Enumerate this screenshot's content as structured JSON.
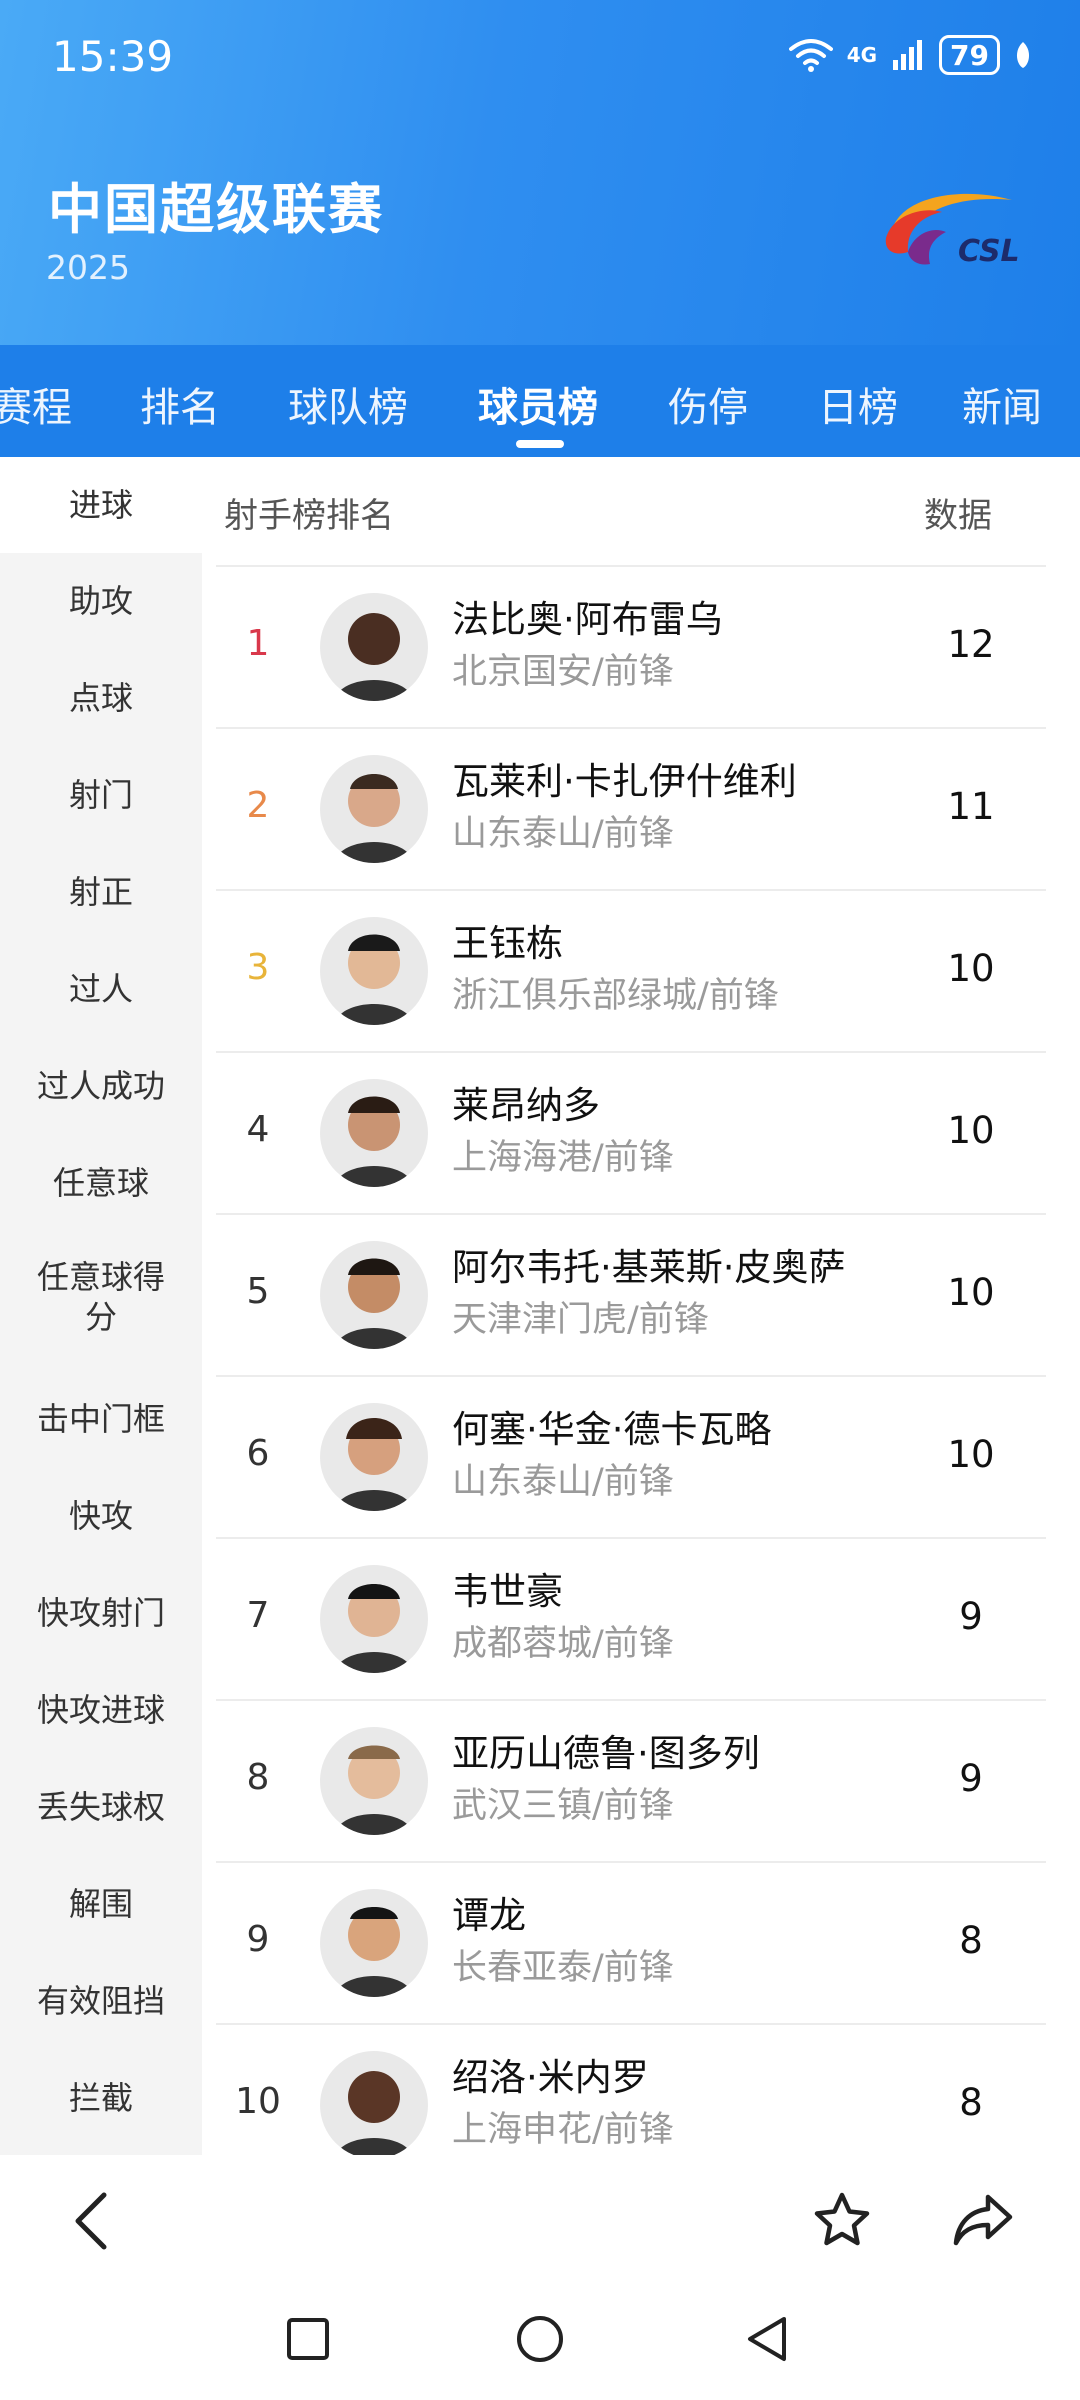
{
  "status": {
    "time": "15:39",
    "network": "4G",
    "battery": "79"
  },
  "league": {
    "title": "中国超级联赛",
    "year": "2025",
    "logo_text": "CSL"
  },
  "tabs": [
    {
      "label": "赛程"
    },
    {
      "label": "排名"
    },
    {
      "label": "球队榜"
    },
    {
      "label": "球员榜",
      "active": true
    },
    {
      "label": "伤停"
    },
    {
      "label": "日榜"
    },
    {
      "label": "新闻"
    }
  ],
  "sidebar": {
    "items": [
      {
        "label": "进球",
        "active": true
      },
      {
        "label": "助攻"
      },
      {
        "label": "点球"
      },
      {
        "label": "射门"
      },
      {
        "label": "射正"
      },
      {
        "label": "过人"
      },
      {
        "label": "过人成功"
      },
      {
        "label": "任意球"
      },
      {
        "label": "任意球得分"
      },
      {
        "label": "击中门框"
      },
      {
        "label": "快攻"
      },
      {
        "label": "快攻射门"
      },
      {
        "label": "快攻进球"
      },
      {
        "label": "丢失球权"
      },
      {
        "label": "解围"
      },
      {
        "label": "有效阻挡"
      },
      {
        "label": "拦截"
      }
    ]
  },
  "list": {
    "title": "射手榜排名",
    "data_header": "数据",
    "rank_colors": {
      "1": "#d9384b",
      "2": "#e8894a",
      "3": "#e8b43a"
    },
    "players": [
      {
        "rank": "1",
        "name": "法比奥·阿布雷乌",
        "team": "北京国安/前锋",
        "value": "12"
      },
      {
        "rank": "2",
        "name": "瓦莱利·卡扎伊什维利",
        "team": "山东泰山/前锋",
        "value": "11"
      },
      {
        "rank": "3",
        "name": "王钰栋",
        "team": "浙江俱乐部绿城/前锋",
        "value": "10"
      },
      {
        "rank": "4",
        "name": "莱昂纳多",
        "team": "上海海港/前锋",
        "value": "10"
      },
      {
        "rank": "5",
        "name": "阿尔韦托·基莱斯·皮奥萨",
        "team": "天津津门虎/前锋",
        "value": "10"
      },
      {
        "rank": "6",
        "name": "何塞·华金·德卡瓦略",
        "team": "山东泰山/前锋",
        "value": "10"
      },
      {
        "rank": "7",
        "name": "韦世豪",
        "team": "成都蓉城/前锋",
        "value": "9"
      },
      {
        "rank": "8",
        "name": "亚历山德鲁·图多列",
        "team": "武汉三镇/前锋",
        "value": "9"
      },
      {
        "rank": "9",
        "name": "谭龙",
        "team": "长春亚泰/前锋",
        "value": "8"
      },
      {
        "rank": "10",
        "name": "绍洛·米内罗",
        "team": "上海申花/前锋",
        "value": "8"
      }
    ]
  },
  "icons": {
    "back": "back-arrow-icon",
    "favorite": "star-icon",
    "share": "share-icon"
  }
}
